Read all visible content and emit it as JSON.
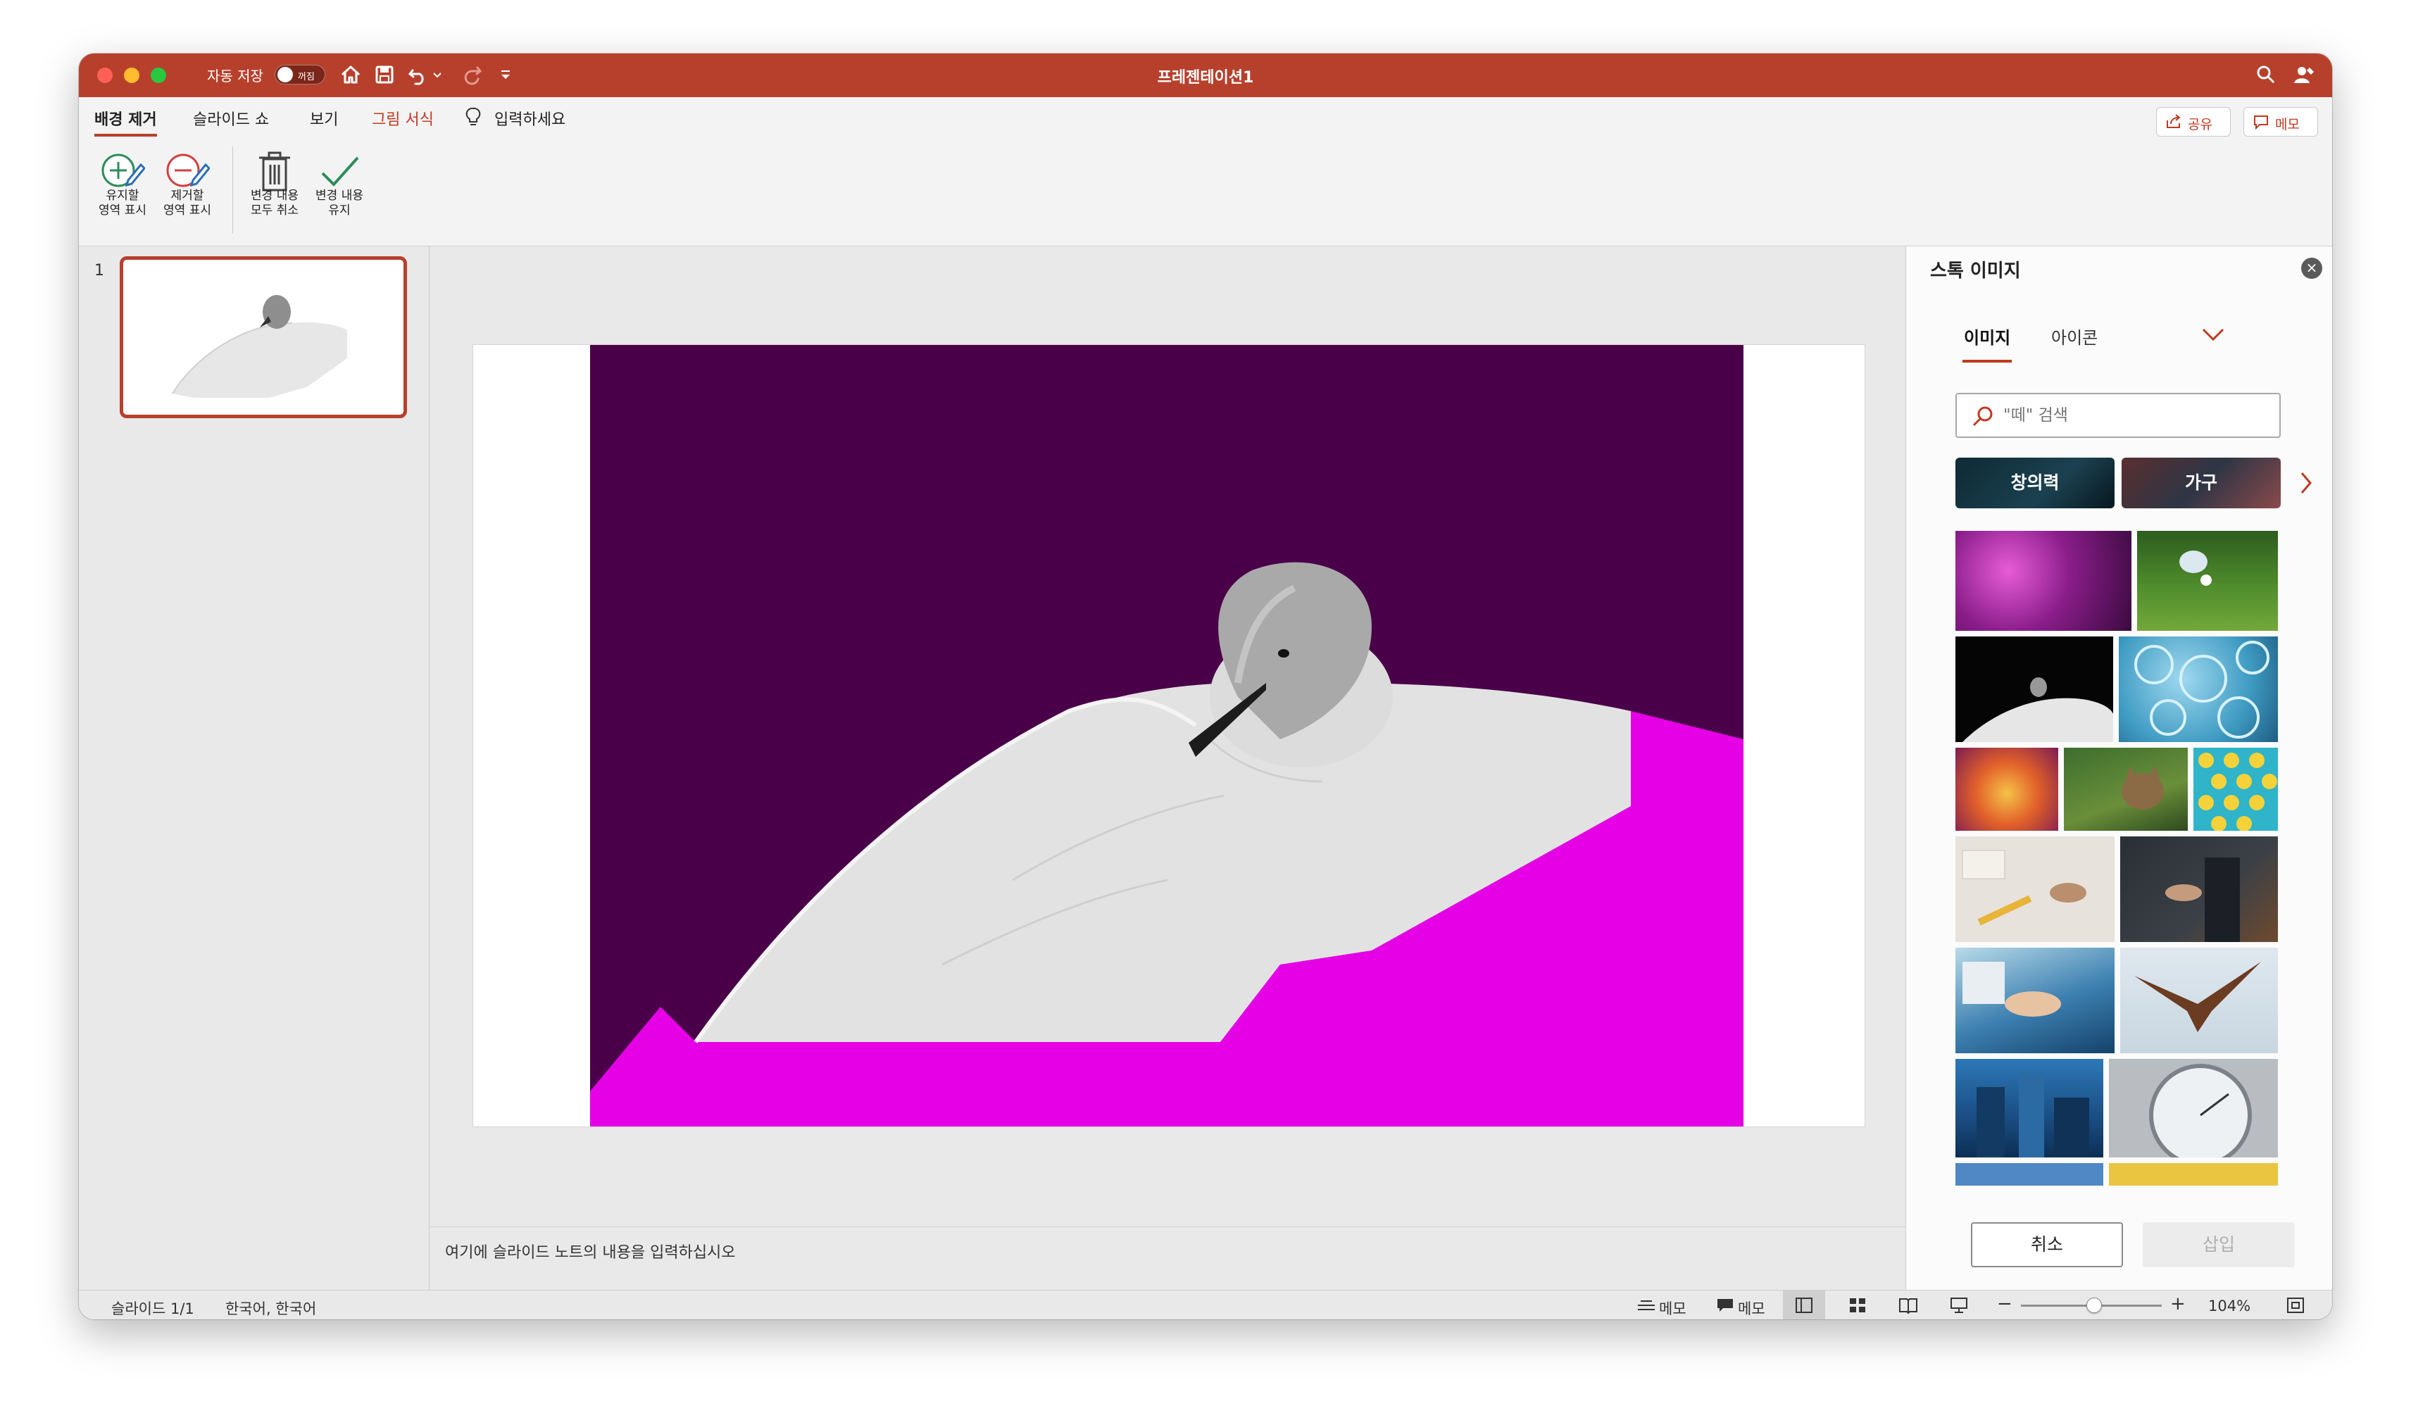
{
  "window": {
    "title": "프레젠테이션1",
    "autosave_label": "자동 저장",
    "autosave_state": "꺼짐"
  },
  "ribbon": {
    "tabs": [
      {
        "label": "배경 제거",
        "active": true
      },
      {
        "label": "슬라이드 쇼"
      },
      {
        "label": "보기"
      },
      {
        "label": "그림 서식",
        "color": "#c0391f"
      }
    ],
    "tell_me": "입력하세요",
    "buttons": [
      {
        "line1": "유지할",
        "line2": "영역 표시",
        "icon": "mark-keep-pencil-icon"
      },
      {
        "line1": "제거할",
        "line2": "영역 표시",
        "icon": "mark-remove-pencil-icon"
      },
      {
        "line1": "변경 내용",
        "line2": "모두 취소",
        "icon": "trash-icon"
      },
      {
        "line1": "변경 내용",
        "line2": "유지",
        "icon": "checkmark-icon"
      }
    ],
    "share_label": "공유",
    "comments_label": "메모"
  },
  "thumbnails": {
    "slide_number": "1"
  },
  "notes": {
    "placeholder": "여기에 슬라이드 노트의 내용을 입력하십시오"
  },
  "stock_pane": {
    "title": "스톡 이미지",
    "tabs": [
      "이미지",
      "아이콘"
    ],
    "search_placeholder": "\"떼\" 검색",
    "categories": [
      "창의력",
      "가구"
    ],
    "cancel_label": "취소",
    "insert_label": "삽입"
  },
  "statusbar": {
    "slide_info": "슬라이드 1/1",
    "language": "한국어, 한국어",
    "notes_label": "메모",
    "comments_label": "메모",
    "zoom_percent": "104%",
    "zoom_level": 0.52
  },
  "colors": {
    "accent": "#b7402c",
    "removal_purple": "#4a0049",
    "removal_magenta": "#e600e6"
  }
}
